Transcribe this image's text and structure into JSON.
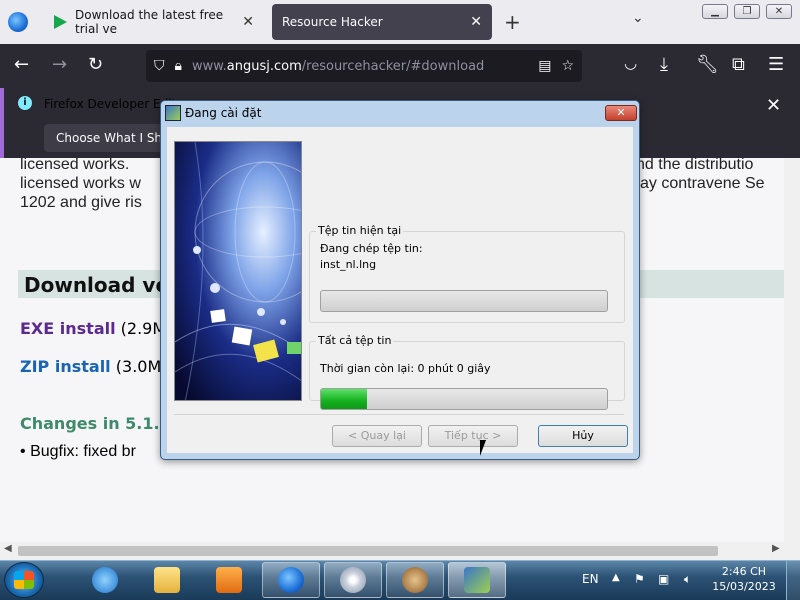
{
  "browser": {
    "tabs": [
      {
        "title": "Download the latest free trial ve"
      },
      {
        "title": "Resource Hacker"
      }
    ],
    "url_prefix": "www.",
    "url_domain": "angusj.com",
    "url_path": "/resourcehacker/#download",
    "notification": {
      "text": "Firefox Developer Edit",
      "button_label": "Choose What I Share"
    }
  },
  "page": {
    "lines": [
      {
        "left": "licensed works.",
        "right": "nd the distributio"
      },
      {
        "left": "licensed works w",
        "right": "ay contravene Se"
      },
      {
        "left": "1202 and give ris",
        "right": ""
      }
    ],
    "download_heading": "Download ve",
    "exe_link": "EXE install",
    "exe_size": "(2.9M",
    "zip_link": "ZIP install",
    "zip_size": "(3.0M",
    "changes_heading": "Changes in 5.1.",
    "bullet_text": "Bugfix: fixed br"
  },
  "dialog": {
    "title": "Đang cài đặt",
    "current_file_group": "Tệp tin hiện tại",
    "copying_label": "Đang chép tệp tin:",
    "current_file": "inst_nl.lng",
    "current_progress": 0,
    "all_files_group": "Tất cả tệp tin",
    "time_remaining": "Thời gian còn lại: 0 phút 0 giây",
    "total_progress": 0.16,
    "back_button": "< Quay lại",
    "next_button": "Tiếp tục >",
    "cancel_button": "Hủy"
  },
  "taskbar": {
    "language": "EN",
    "time": "2:46 CH",
    "date": "15/03/2023"
  },
  "colors": {
    "progress_green": "#14b11e",
    "accent_purple": "#a06ad9"
  }
}
